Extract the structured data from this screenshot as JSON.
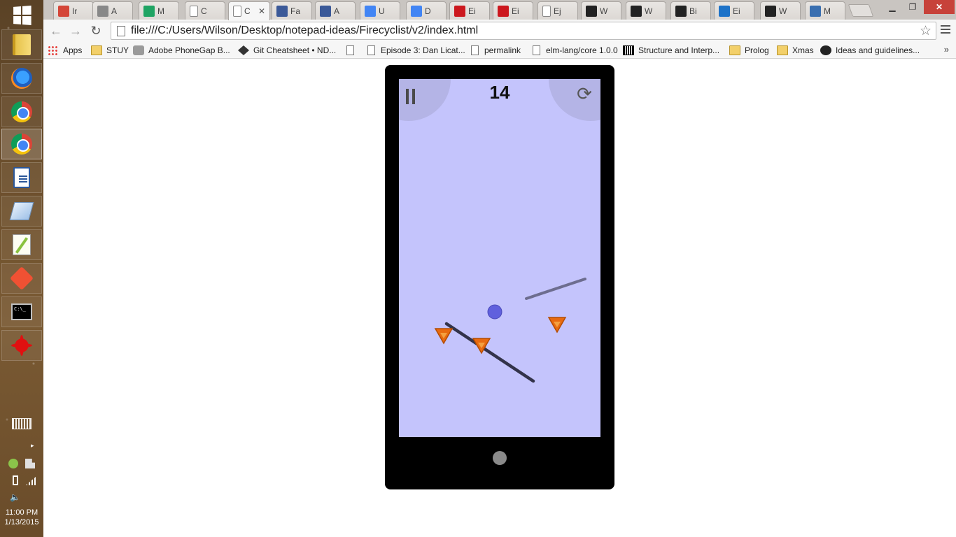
{
  "taskbar": {
    "icons": [
      "windows-start",
      "file-explorer",
      "firefox",
      "chrome",
      "chrome",
      "word-document",
      "eraser-app",
      "notepad-plus-plus",
      "git",
      "command-prompt",
      "splat-app"
    ],
    "active_index": 4,
    "clock_time": "11:00 PM",
    "clock_date": "1/13/2015"
  },
  "browser": {
    "tabs": [
      {
        "title": "Ir",
        "icon": "gmail-icon",
        "color": "#d44638"
      },
      {
        "title": "A",
        "icon": "contacts-icon",
        "color": "#888888"
      },
      {
        "title": "M",
        "icon": "drive-icon",
        "color": "#1fa463"
      },
      {
        "title": "C",
        "icon": "page-icon",
        "color": "#ffffff"
      },
      {
        "title": "C",
        "icon": "page-icon",
        "color": "#ffffff",
        "active": true
      },
      {
        "title": "Fa",
        "icon": "facebook-icon",
        "color": "#3b5998"
      },
      {
        "title": "A",
        "icon": "facebook-icon",
        "color": "#3b5998"
      },
      {
        "title": "U",
        "icon": "docs-icon",
        "color": "#4285f4"
      },
      {
        "title": "D",
        "icon": "docs-icon",
        "color": "#4285f4"
      },
      {
        "title": "Ei",
        "icon": "youtube-icon",
        "color": "#cc181e"
      },
      {
        "title": "Ei",
        "icon": "youtube-icon",
        "color": "#cc181e"
      },
      {
        "title": "Ej",
        "icon": "page-icon",
        "color": "#ffffff"
      },
      {
        "title": "W",
        "icon": "github-icon",
        "color": "#222222"
      },
      {
        "title": "W",
        "icon": "media-icon",
        "color": "#222222"
      },
      {
        "title": "Bi",
        "icon": "media-icon",
        "color": "#222222"
      },
      {
        "title": "Ei",
        "icon": "ie-icon",
        "color": "#1e73c8"
      },
      {
        "title": "W",
        "icon": "github-icon",
        "color": "#222222"
      },
      {
        "title": "M",
        "icon": "moon-icon",
        "color": "#3a6fb0"
      }
    ],
    "url": "file:///C:/Users/Wilson/Desktop/notepad-ideas/Firecyclist/v2/index.html",
    "bookmarks": [
      {
        "label": "Apps",
        "icon": "apps"
      },
      {
        "label": "STUY",
        "icon": "folder"
      },
      {
        "label": "Adobe PhoneGap B...",
        "icon": "pg"
      },
      {
        "label": "Git Cheatsheet • ND...",
        "icon": "gitc"
      },
      {
        "label": "",
        "icon": "page"
      },
      {
        "label": "Episode 3: Dan Licat...",
        "icon": "page"
      },
      {
        "label": "permalink",
        "icon": "page"
      },
      {
        "label": "elm-lang/core 1.0.0",
        "icon": "page"
      },
      {
        "label": "Structure and Interp...",
        "icon": "sicp"
      },
      {
        "label": "Prolog",
        "icon": "folder"
      },
      {
        "label": "Xmas",
        "icon": "folder"
      },
      {
        "label": "Ideas and guidelines...",
        "icon": "gh"
      }
    ],
    "more_label": "»"
  },
  "game": {
    "score": "14",
    "pause_icon": "pause-icon",
    "restart_icon": "restart-icon",
    "colors": {
      "background": "#c4c4fc",
      "ball": "#6060dd",
      "fire": "#e86a10",
      "line_active": "#33334a",
      "line_faded": "#6d6d8f"
    }
  }
}
